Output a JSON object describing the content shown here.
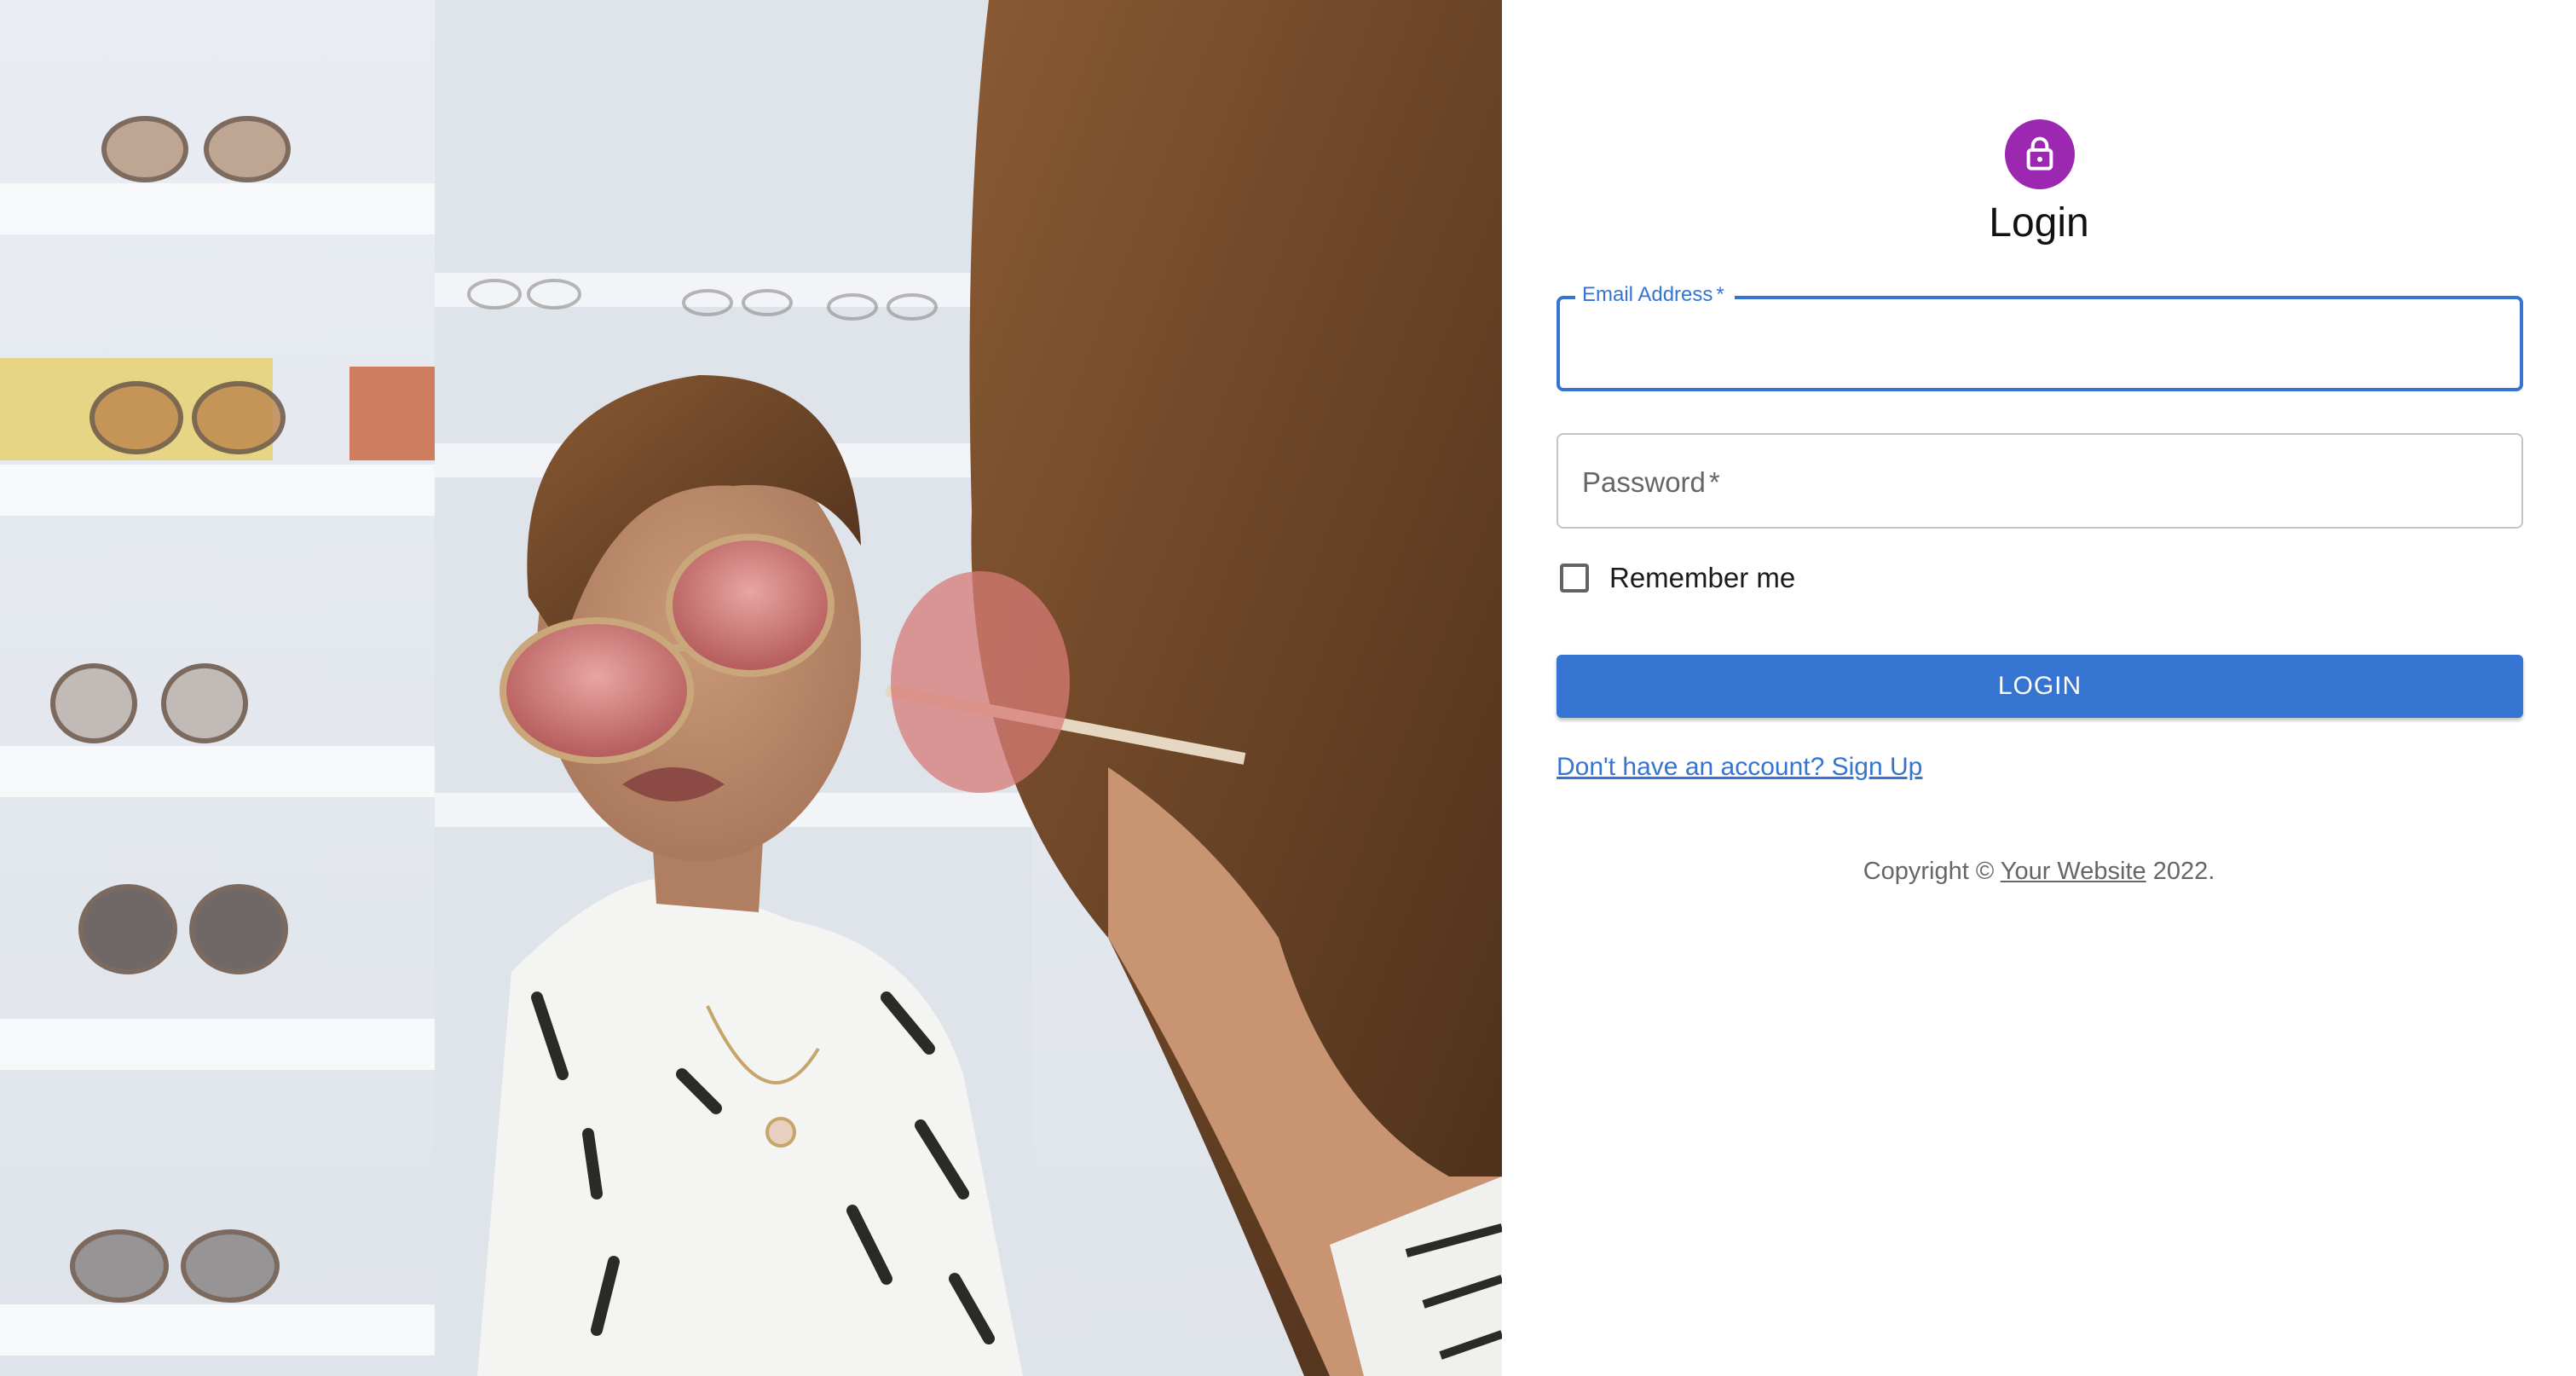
{
  "hero": {
    "image": "woman-trying-sunglasses-in-mirror-photo"
  },
  "login": {
    "icon": "lock-icon",
    "accent_color": "#9c27b0",
    "title": "Login",
    "email": {
      "label": "Email Address",
      "required_mark": "*",
      "value": ""
    },
    "password": {
      "label": "Password",
      "required_mark": "*",
      "value": ""
    },
    "remember_me": {
      "label": "Remember me",
      "checked": false
    },
    "submit_label": "LOGIN",
    "primary_color": "#3574d1",
    "signup_link": "Don't have an account? Sign Up"
  },
  "footer": {
    "prefix": "Copyright © ",
    "link": "Your Website",
    "suffix": " 2022."
  }
}
